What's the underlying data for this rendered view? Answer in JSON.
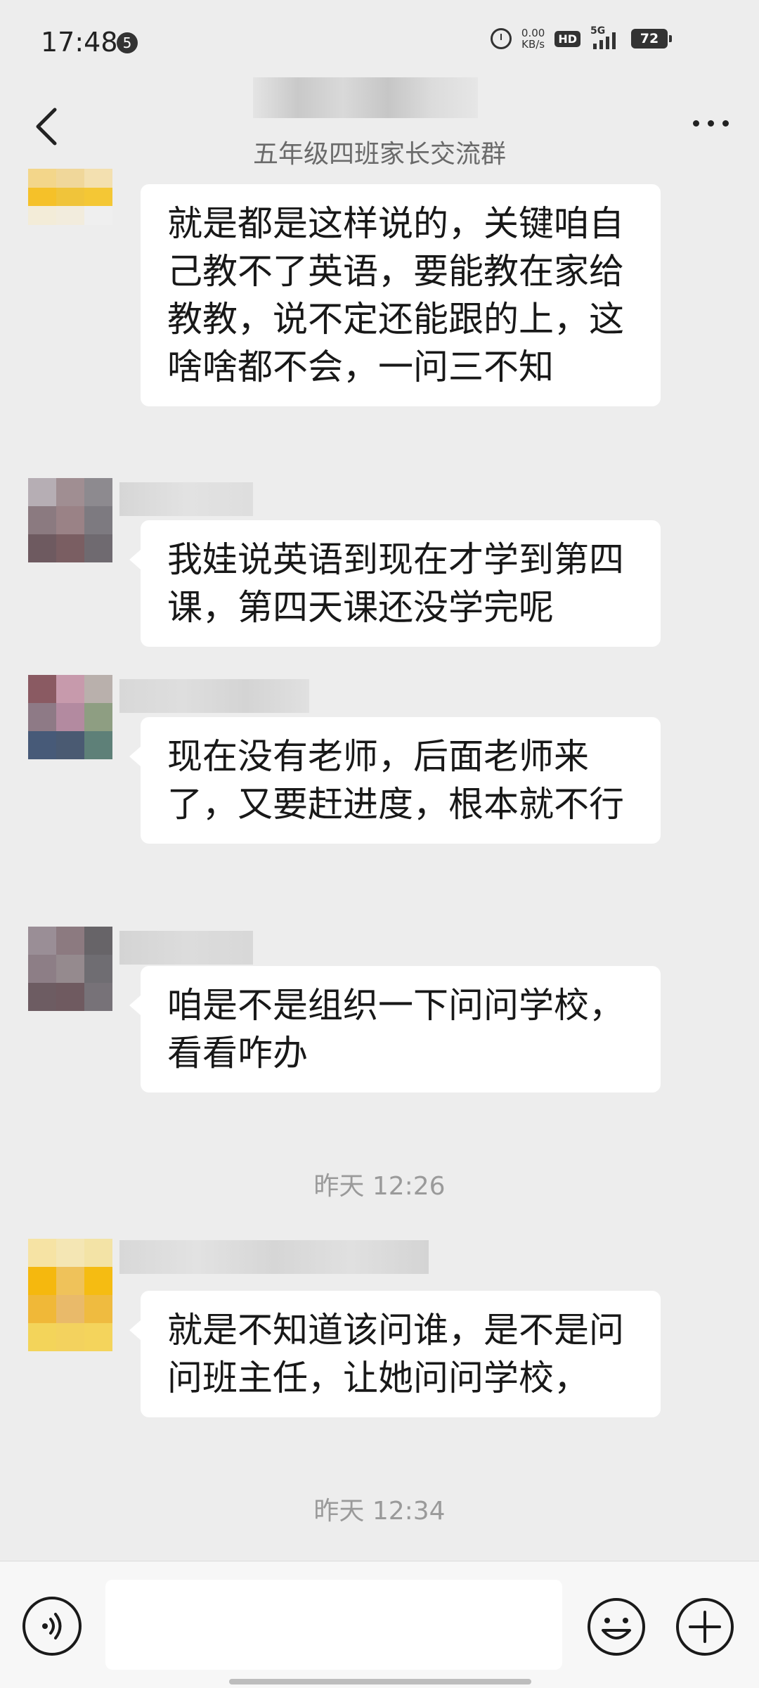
{
  "status_bar": {
    "time": "17:48",
    "notification_count": "5",
    "net_speed_value": "0.00",
    "net_speed_unit": "KB/s",
    "hd_label": "HD",
    "network_label": "5G",
    "battery": "72"
  },
  "header": {
    "title": "五年级四班家长交流群"
  },
  "messages": [
    {
      "text": "就是都是这样说的，关键咱自己教不了英语，要能教在家给教教，说不定还能跟的上，这啥啥都不会，一问三不知"
    },
    {
      "text": "我娃说英语到现在才学到第四课，第四天课还没学完呢"
    },
    {
      "text": "现在没有老师，后面老师来了，又要赶进度，根本就不行"
    },
    {
      "text": "咱是不是组织一下问问学校，看看咋办"
    },
    {
      "text": "就是不知道该问谁，是不是问问班主任，让她问问学校，"
    }
  ],
  "timestamps": [
    "昨天 12:26",
    "昨天 12:34"
  ],
  "input": {
    "value": "",
    "placeholder": ""
  },
  "icons": {
    "back": "chevron-left-icon",
    "more": "more-dots-icon",
    "voice": "voice-icon",
    "emoji": "emoji-icon",
    "plus": "plus-icon"
  },
  "colors": {
    "background": "#ededed",
    "bubble": "#ffffff",
    "title_text": "#6a6a6a",
    "timestamp_text": "#9a9a9a"
  }
}
